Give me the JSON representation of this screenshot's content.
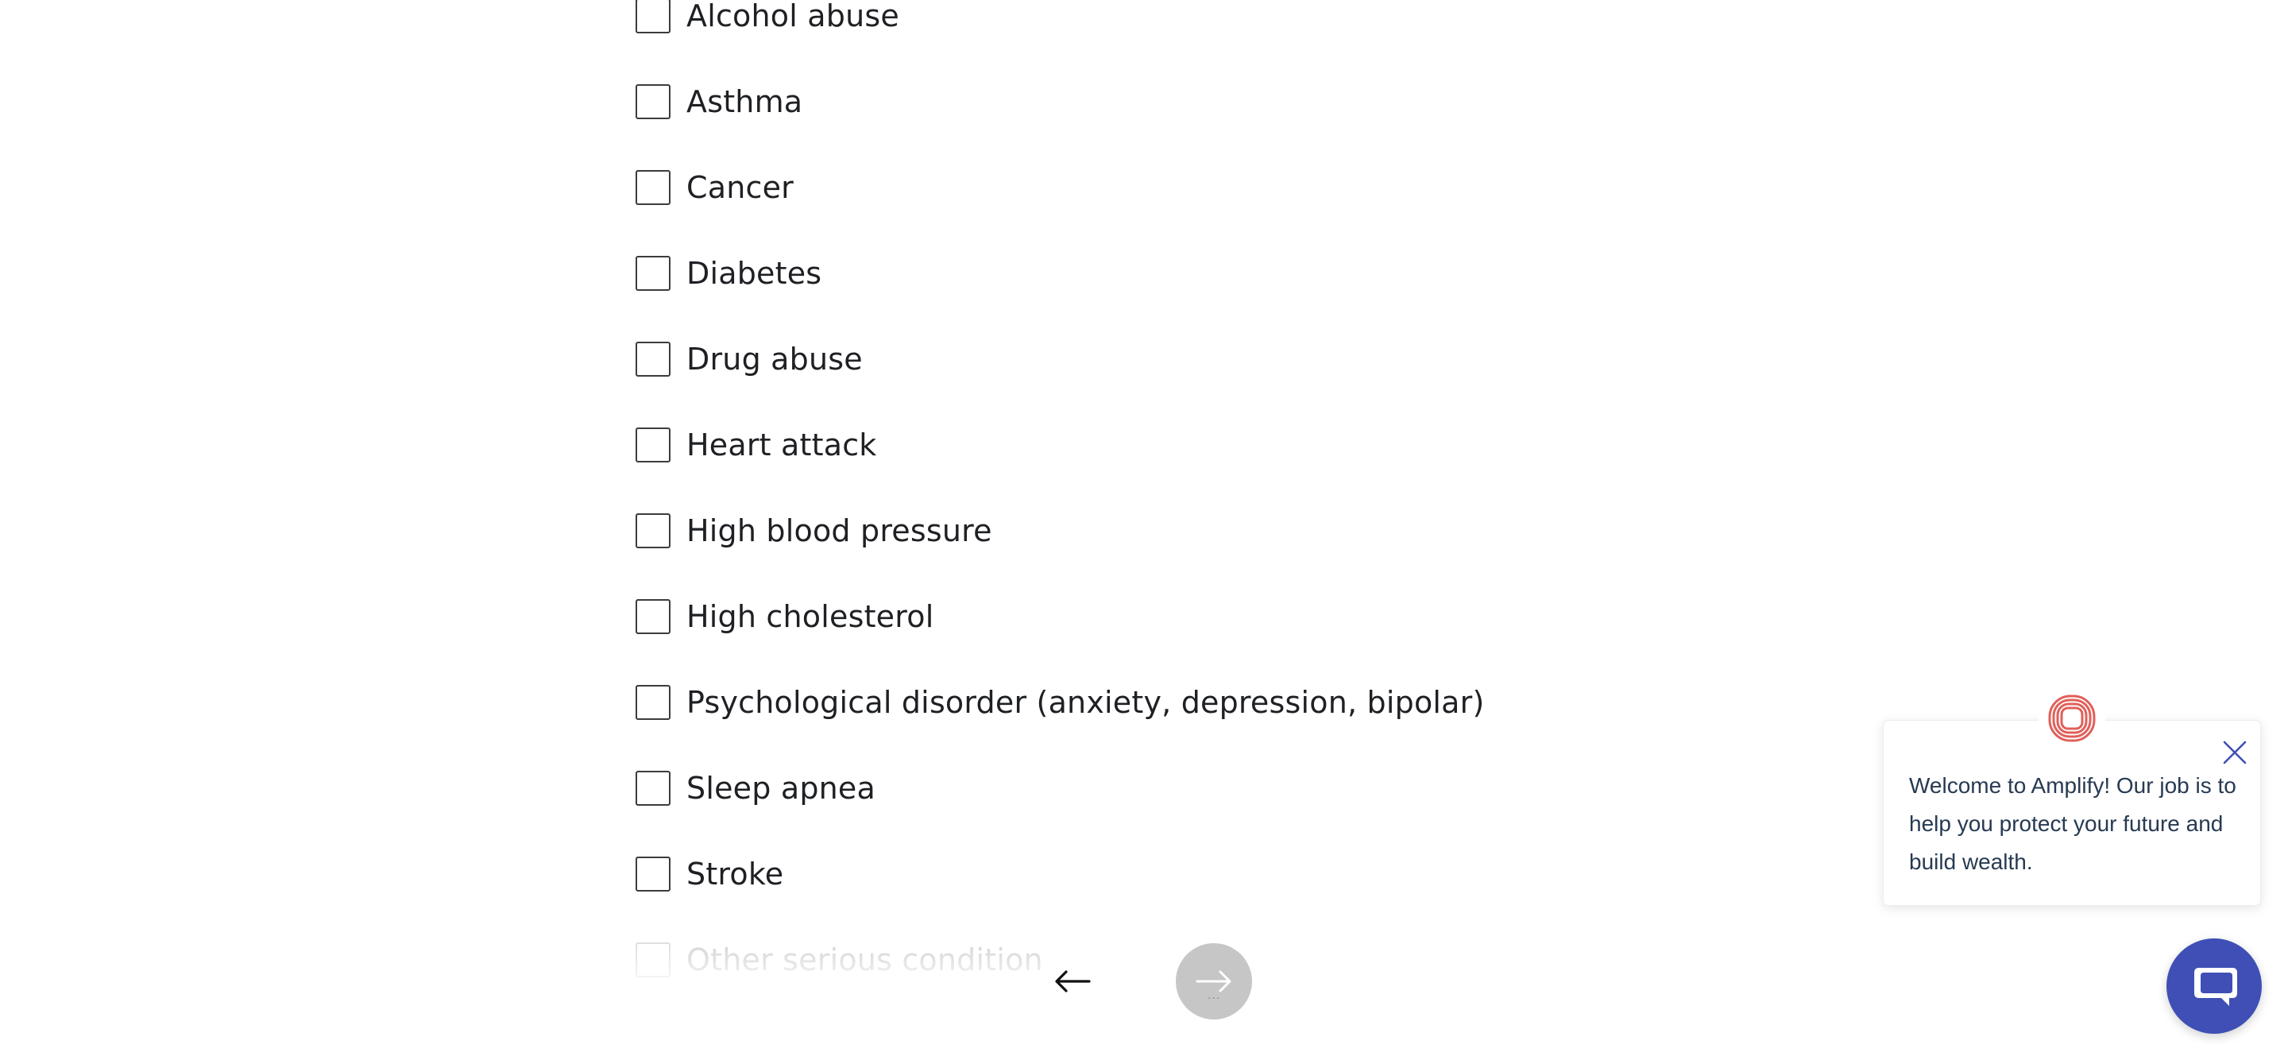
{
  "conditions": {
    "items": [
      {
        "label": "Alcohol abuse"
      },
      {
        "label": "Asthma"
      },
      {
        "label": "Cancer"
      },
      {
        "label": "Diabetes"
      },
      {
        "label": "Drug abuse"
      },
      {
        "label": "Heart attack"
      },
      {
        "label": "High blood pressure"
      },
      {
        "label": "High cholesterol"
      },
      {
        "label": "Psychological disorder (anxiety, depression, bipolar)"
      },
      {
        "label": "Sleep apnea"
      },
      {
        "label": "Stroke"
      },
      {
        "label": "Other serious condition"
      }
    ]
  },
  "navigation": {
    "back_icon": "arrow-left-icon",
    "next_icon": "arrow-right-icon",
    "next_state": "disabled",
    "next_dots": "..."
  },
  "chat": {
    "logo_icon": "amplify-logo-icon",
    "close_icon": "close-icon",
    "message": "Welcome to Amplify! Our job is to help you protect your future and build wealth.",
    "launcher_icon": "chat-bubbles-icon",
    "accent_color": "#3f4fb5",
    "logo_color": "#e0605a"
  }
}
